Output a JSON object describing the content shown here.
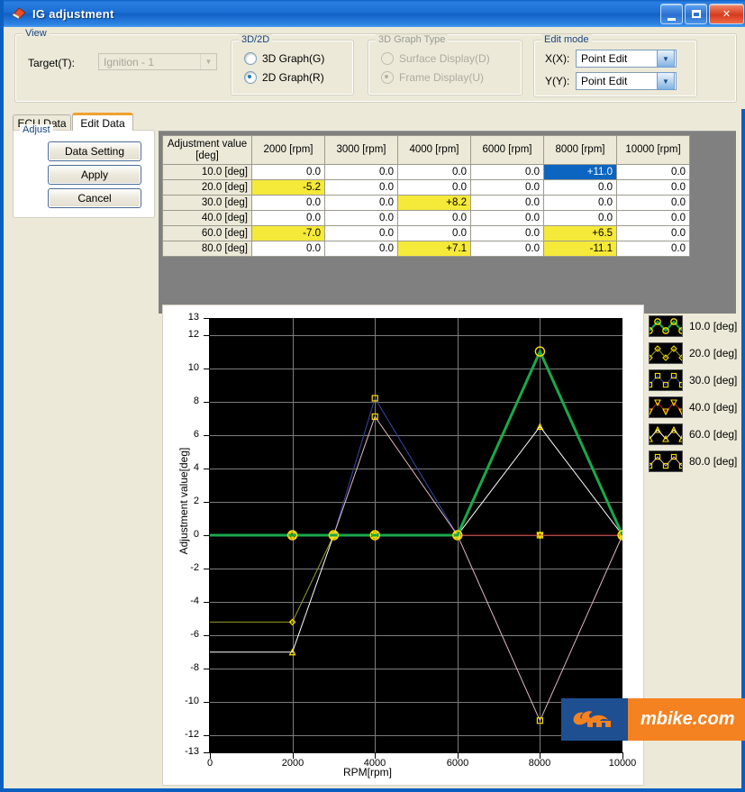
{
  "window": {
    "title": "IG adjustment",
    "icon": "app-icon",
    "buttons": {
      "minimize": "minimize-icon",
      "maximize": "maximize-icon",
      "close": "close-icon"
    }
  },
  "view_group": {
    "title": "View",
    "target_label": "Target(T):",
    "target_value": "Ignition - 1",
    "target_disabled": true
  },
  "graph_mode_group": {
    "title": "3D/2D",
    "options": [
      {
        "label": "3D Graph(G)",
        "selected": false
      },
      {
        "label": "2D Graph(R)",
        "selected": true
      }
    ]
  },
  "graph_type_group": {
    "title": "3D Graph Type",
    "disabled": true,
    "options": [
      {
        "label": "Surface Display(D)",
        "selected": false
      },
      {
        "label": "Frame Display(U)",
        "selected": true
      }
    ]
  },
  "edit_mode_group": {
    "title": "Edit mode",
    "rows": [
      {
        "label": "X(X):",
        "value": "Point Edit"
      },
      {
        "label": "Y(Y):",
        "value": "Point Edit"
      }
    ]
  },
  "tabs": [
    {
      "label": "ECU Data",
      "active": false
    },
    {
      "label": "Edit Data",
      "active": true
    }
  ],
  "adjust_panel": {
    "title": "Adjust",
    "buttons": [
      {
        "label": "Data Setting"
      },
      {
        "label": "Apply"
      },
      {
        "label": "Cancel"
      }
    ]
  },
  "table": {
    "corner_header_line1": "Adjustment value",
    "corner_header_line2": "[deg]",
    "columns": [
      "2000 [rpm]",
      "3000 [rpm]",
      "4000 [rpm]",
      "6000 [rpm]",
      "8000 [rpm]",
      "10000 [rpm]"
    ],
    "rows": [
      {
        "label": "10.0 [deg]",
        "cells": [
          {
            "v": "0.0",
            "state": "normal"
          },
          {
            "v": "0.0",
            "state": "normal"
          },
          {
            "v": "0.0",
            "state": "normal"
          },
          {
            "v": "0.0",
            "state": "normal"
          },
          {
            "v": "+11.0",
            "state": "selected"
          },
          {
            "v": "0.0",
            "state": "normal"
          }
        ]
      },
      {
        "label": "20.0 [deg]",
        "cells": [
          {
            "v": "-5.2",
            "state": "highlight"
          },
          {
            "v": "0.0",
            "state": "normal"
          },
          {
            "v": "0.0",
            "state": "normal"
          },
          {
            "v": "0.0",
            "state": "normal"
          },
          {
            "v": "0.0",
            "state": "normal"
          },
          {
            "v": "0.0",
            "state": "normal"
          }
        ]
      },
      {
        "label": "30.0 [deg]",
        "cells": [
          {
            "v": "0.0",
            "state": "normal"
          },
          {
            "v": "0.0",
            "state": "normal"
          },
          {
            "v": "+8.2",
            "state": "highlight"
          },
          {
            "v": "0.0",
            "state": "normal"
          },
          {
            "v": "0.0",
            "state": "normal"
          },
          {
            "v": "0.0",
            "state": "normal"
          }
        ]
      },
      {
        "label": "40.0 [deg]",
        "cells": [
          {
            "v": "0.0",
            "state": "normal"
          },
          {
            "v": "0.0",
            "state": "normal"
          },
          {
            "v": "0.0",
            "state": "normal"
          },
          {
            "v": "0.0",
            "state": "normal"
          },
          {
            "v": "0.0",
            "state": "normal"
          },
          {
            "v": "0.0",
            "state": "normal"
          }
        ]
      },
      {
        "label": "60.0 [deg]",
        "cells": [
          {
            "v": "-7.0",
            "state": "highlight"
          },
          {
            "v": "0.0",
            "state": "normal"
          },
          {
            "v": "0.0",
            "state": "normal"
          },
          {
            "v": "0.0",
            "state": "normal"
          },
          {
            "v": "+6.5",
            "state": "highlight"
          },
          {
            "v": "0.0",
            "state": "normal"
          }
        ]
      },
      {
        "label": "80.0 [deg]",
        "cells": [
          {
            "v": "0.0",
            "state": "normal"
          },
          {
            "v": "0.0",
            "state": "normal"
          },
          {
            "v": "+7.1",
            "state": "highlight"
          },
          {
            "v": "0.0",
            "state": "normal"
          },
          {
            "v": "-11.1",
            "state": "highlight"
          },
          {
            "v": "0.0",
            "state": "normal"
          }
        ]
      }
    ]
  },
  "chart_data": {
    "type": "line",
    "title": "",
    "xlabel": "RPM[rpm]",
    "ylabel": "Adjustment value[deg]",
    "xlim": [
      0,
      10000
    ],
    "ylim": [
      -13,
      13
    ],
    "grid": true,
    "legend_position": "right",
    "background": "#000000",
    "x_ticks": [
      0,
      2000,
      4000,
      6000,
      8000,
      10000
    ],
    "x_tick_labels": [
      "0",
      "2000",
      "4000",
      "6000",
      "8000",
      "10000"
    ],
    "y_ticks": [
      13,
      12,
      10,
      8,
      6,
      4,
      2,
      0,
      -2,
      -4,
      -6,
      -8,
      -10,
      -12,
      -13
    ],
    "y_tick_labels": [
      "13",
      "12",
      "10",
      "8",
      "6",
      "4",
      "2",
      "0",
      "-2",
      "-4",
      "-6",
      "-8",
      "-10",
      "-12",
      "-13"
    ],
    "x": [
      0,
      2000,
      3000,
      4000,
      6000,
      8000,
      10000
    ],
    "series": [
      {
        "name": "10.0 [deg]",
        "color": "#1aa84a",
        "marker": "circle",
        "marker_color": "#ffe000",
        "width": 3,
        "active": true,
        "values": [
          0.0,
          0.0,
          0.0,
          0.0,
          0.0,
          11.0,
          0.0
        ]
      },
      {
        "name": "20.0 [deg]",
        "color": "#9a9a2a",
        "marker": "diamond",
        "marker_color": "#ffe000",
        "width": 1,
        "active": false,
        "values": [
          -5.2,
          -5.2,
          0.0,
          0.0,
          0.0,
          0.0,
          0.0
        ]
      },
      {
        "name": "30.0 [deg]",
        "color": "#3848a8",
        "marker": "square",
        "marker_color": "#ffe000",
        "width": 1,
        "active": false,
        "values": [
          0.0,
          0.0,
          0.0,
          8.2,
          0.0,
          0.0,
          0.0
        ]
      },
      {
        "name": "40.0 [deg]",
        "color": "#c02020",
        "marker": "triangle-down",
        "marker_color": "#ffe000",
        "width": 1,
        "active": false,
        "values": [
          0.0,
          0.0,
          0.0,
          0.0,
          0.0,
          0.0,
          0.0
        ]
      },
      {
        "name": "60.0 [deg]",
        "color": "#ffffff",
        "marker": "triangle-up",
        "marker_color": "#ffe000",
        "width": 1,
        "active": false,
        "values": [
          -7.0,
          -7.0,
          0.0,
          0.0,
          0.0,
          6.5,
          0.0
        ]
      },
      {
        "name": "80.0 [deg]",
        "color": "#e0b8c0",
        "marker": "square",
        "marker_color": "#ffe000",
        "width": 1,
        "active": false,
        "values": [
          0.0,
          0.0,
          0.0,
          7.1,
          0.0,
          -11.1,
          0.0
        ]
      }
    ]
  },
  "watermark": {
    "text": "mbike.com",
    "logo": "mbike-flame-logo",
    "bg": "#f58220",
    "logo_bg": "#1d4f91"
  }
}
